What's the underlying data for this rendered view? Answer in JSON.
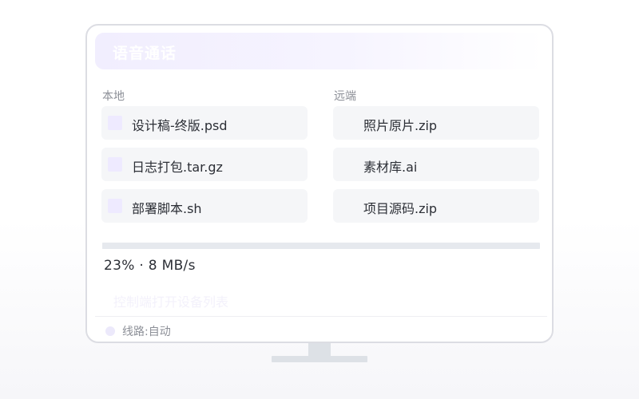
{
  "window": {
    "title": "语音通话"
  },
  "local": {
    "label": "本地",
    "files": [
      {
        "name": "设计稿-终版.psd"
      },
      {
        "name": "日志打包.tar.gz"
      },
      {
        "name": "部署脚本.sh"
      }
    ]
  },
  "remote": {
    "label": "远端",
    "files": [
      {
        "name": "照片原片.zip"
      },
      {
        "name": "素材库.ai"
      },
      {
        "name": "项目源码.zip"
      }
    ]
  },
  "transfer": {
    "progress_percent": 23,
    "status_text": "23% · 8 MB/s"
  },
  "controller": {
    "text": "控制端打开设备列表"
  },
  "status": {
    "text": "线路:自动"
  },
  "colors": {
    "accent_light": "#eeeaff",
    "text_primary": "#2c2f36",
    "text_secondary": "#8c8f97",
    "item_bg": "#f5f6f8"
  }
}
